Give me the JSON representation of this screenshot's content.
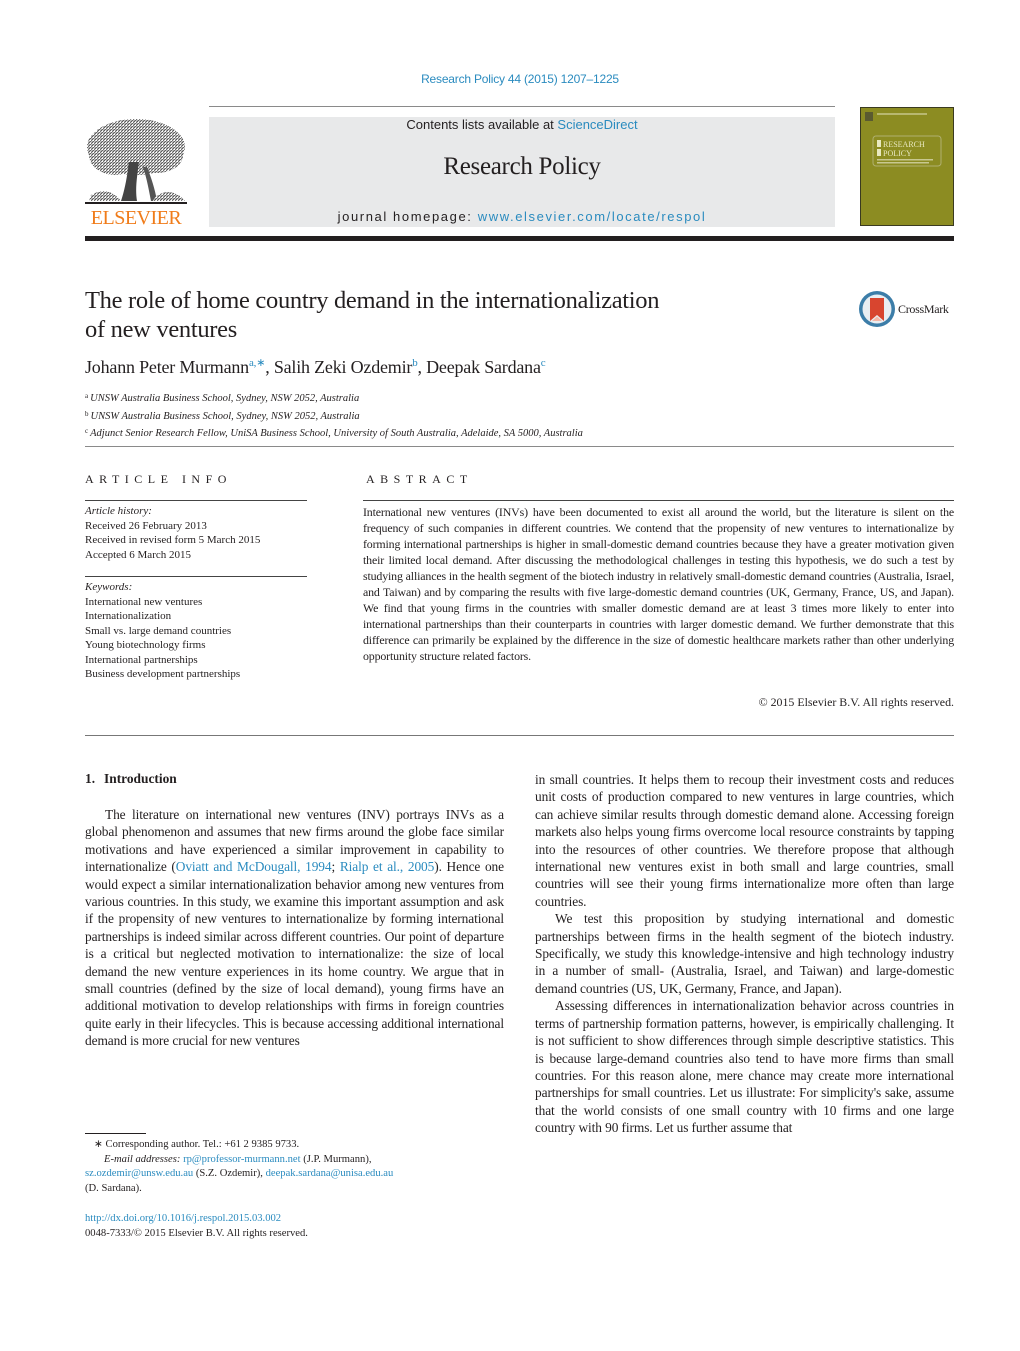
{
  "header": {
    "citation": "Research Policy 44 (2015) 1207–1225",
    "contents_prefix": "Contents lists available at ",
    "contents_link": "ScienceDirect",
    "journal_name": "Research Policy",
    "homepage_prefix": "journal homepage: ",
    "homepage_link": "www.elsevier.com/locate/respol",
    "publisher_logo_text": "ELSEVIER",
    "cover_title_line1": "RESEARCH",
    "cover_title_line2": "POLICY",
    "colors": {
      "link": "#2a8bbf",
      "elsevier_orange": "#f07c1a",
      "cover_olive": "#8c8c22",
      "banner_gray": "#e8e9ea"
    }
  },
  "article": {
    "title_line1": "The role of home country demand in the internationalization",
    "title_line2": "of new ventures",
    "crossmark_label": "CrossMark",
    "authors": [
      {
        "name": "Johann Peter Murmann",
        "sup": "a,∗"
      },
      {
        "name": "Salih Zeki Ozdemir",
        "sup": "b"
      },
      {
        "name": "Deepak Sardana",
        "sup": "c"
      }
    ],
    "affiliations": [
      {
        "key": "a",
        "text": "UNSW Australia Business School, Sydney, NSW 2052, Australia"
      },
      {
        "key": "b",
        "text": "UNSW Australia Business School, Sydney, NSW 2052, Australia"
      },
      {
        "key": "c",
        "text": "Adjunct Senior Research Fellow, UniSA Business School, University of South Australia, Adelaide, SA 5000, Australia"
      }
    ]
  },
  "article_info": {
    "heading": "ARTICLE INFO",
    "history_label": "Article history:",
    "history": [
      "Received 26 February 2013",
      "Received in revised form 5 March 2015",
      "Accepted 6 March 2015"
    ],
    "keywords_label": "Keywords:",
    "keywords": [
      "International new ventures",
      "Internationalization",
      "Small vs. large demand countries",
      "Young biotechnology firms",
      "International partnerships",
      "Business development partnerships"
    ]
  },
  "abstract": {
    "heading": "ABSTRACT",
    "text": "International new ventures (INVs) have been documented to exist all around the world, but the literature is silent on the frequency of such companies in different countries. We contend that the propensity of new ventures to internationalize by forming international partnerships is higher in small-domestic demand countries because they have a greater motivation given their limited local demand. After discussing the methodological challenges in testing this hypothesis, we do such a test by studying alliances in the health segment of the biotech industry in relatively small-domestic demand countries (Australia, Israel, and Taiwan) and by comparing the results with five large-domestic demand countries (UK, Germany, France, US, and Japan). We find that young firms in the countries with smaller domestic demand are at least 3 times more likely to enter into international partnerships than their counterparts in countries with larger domestic demand. We further demonstrate that this difference can primarily be explained by the difference in the size of domestic healthcare markets rather than other underlying opportunity structure related factors.",
    "copyright": "© 2015 Elsevier B.V. All rights reserved."
  },
  "body": {
    "section_number": "1.",
    "section_title": "Introduction",
    "left_p1_before": "The literature on international new ventures (INV) portrays INVs as a global phenomenon and assumes that new firms around the globe face similar motivations and have experienced a similar improvement in capability to internationalize (",
    "left_p1_cite1": "Oviatt and McDougall, 1994",
    "left_p1_sep": "; ",
    "left_p1_cite2": "Rialp et al., 2005",
    "left_p1_after": "). Hence one would expect a similar internationalization behavior among new ventures from various countries. In this study, we examine this important assumption and ask if the propensity of new ventures to internationalize by forming international partnerships is indeed similar across different countries. Our point of departure is a critical but neglected motivation to internationalize: the size of local demand the new venture experiences in its home country. We argue that in small countries (defined by the size of local demand), young firms have an additional motivation to develop relationships with firms in foreign countries quite early in their lifecycles. This is because accessing additional international demand is more crucial for new ventures",
    "right_p1": "in small countries. It helps them to recoup their investment costs and reduces unit costs of production compared to new ventures in large countries, which can achieve similar results through domestic demand alone. Accessing foreign markets also helps young firms overcome local resource constraints by tapping into the resources of other countries. We therefore propose that although international new ventures exist in both small and large countries, small countries will see their young firms internationalize more often than large countries.",
    "right_p2": "We test this proposition by studying international and domestic partnerships between firms in the health segment of the biotech industry. Specifically, we study this knowledge-intensive and high technology industry in a number of small- (Australia, Israel, and Taiwan) and large-domestic demand countries (US, UK, Germany, France, and Japan).",
    "right_p3": "Assessing differences in internationalization behavior across countries in terms of partnership formation patterns, however, is empirically challenging. It is not sufficient to show differences through simple descriptive statistics. This is because large-demand countries also tend to have more firms than small countries. For this reason alone, mere chance may create more international partnerships for small countries. Let us illustrate: For simplicity's sake, assume that the world consists of one small country with 10 firms and one large country with 90 firms. Let us further assume that"
  },
  "footnotes": {
    "corresponding": "∗  Corresponding author. Tel.: +61 2 9385 9733.",
    "email_label": "E-mail addresses: ",
    "email1": "rp@professor-murmann.net",
    "email1_owner": " (J.P. Murmann),",
    "email2": "sz.ozdemir@unsw.edu.au",
    "email2_owner": " (S.Z. Ozdemir), ",
    "email3": "deepak.sardana@unisa.edu.au",
    "email3_owner": "(D. Sardana).",
    "doi": "http://dx.doi.org/10.1016/j.respol.2015.03.002",
    "issn_line": "0048-7333/© 2015 Elsevier B.V. All rights reserved."
  }
}
